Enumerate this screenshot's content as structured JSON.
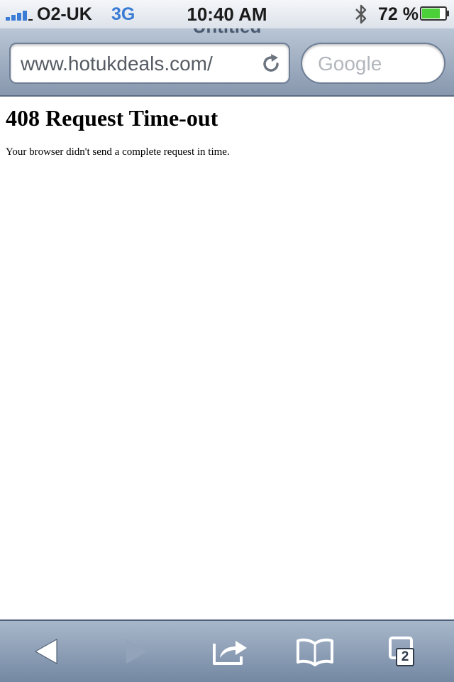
{
  "status_bar": {
    "carrier": "O2-UK",
    "network": "3G",
    "time": "10:40 AM",
    "battery_percent": "72 %",
    "signal_icon": "signal-bars-icon",
    "bluetooth_icon": "bluetooth-icon",
    "battery_icon": "battery-icon"
  },
  "browser": {
    "page_title": "Untitled",
    "url": "www.hotukdeals.com/",
    "search_placeholder": "Google",
    "reload_icon": "reload-icon"
  },
  "page": {
    "heading": "408 Request Time-out",
    "message": "Your browser didn't send a complete request in time."
  },
  "toolbar": {
    "back_icon": "back-arrow-icon",
    "forward_icon": "forward-arrow-icon",
    "share_icon": "share-icon",
    "bookmarks_icon": "bookmarks-book-icon",
    "tabs_icon": "tabs-icon",
    "tabs_count": "2"
  },
  "colors": {
    "accent_blue": "#3a7bd5",
    "battery_green": "#4cd03a",
    "toolbar_blue": "#7488a3",
    "navbar_blue": "#8797ad"
  }
}
